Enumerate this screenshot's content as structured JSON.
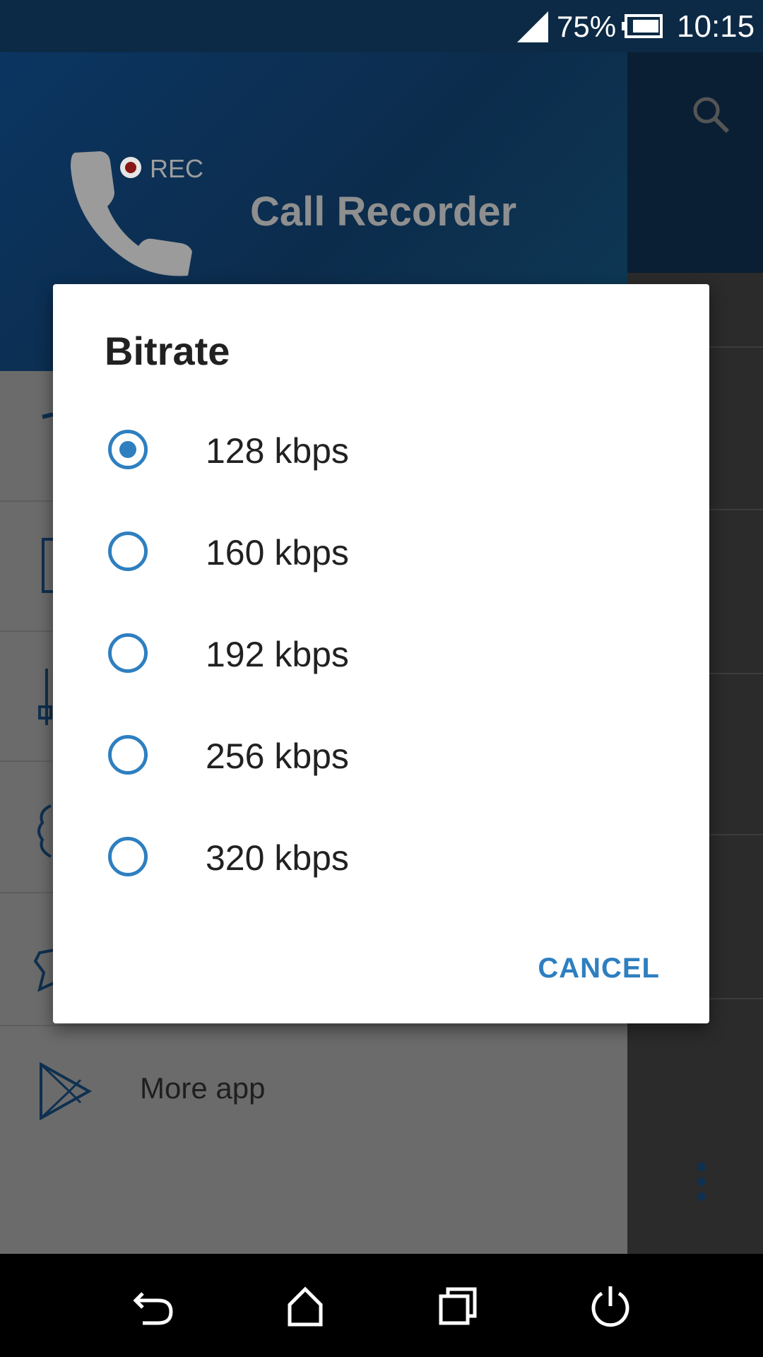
{
  "status_bar": {
    "battery_percent": "75%",
    "time": "10:15"
  },
  "drawer": {
    "header": {
      "rec_label": "REC",
      "app_title": "Call Recorder"
    },
    "items": [
      {
        "icon": "shield-icon"
      },
      {
        "icon": "sd-card-icon"
      },
      {
        "icon": "equalizer-icon"
      },
      {
        "icon": "gear-icon"
      },
      {
        "icon": "star-icon"
      },
      {
        "icon": "play-store-icon",
        "label": "More app"
      }
    ]
  },
  "dialog": {
    "title": "Bitrate",
    "options": [
      {
        "label": "128 kbps",
        "selected": true
      },
      {
        "label": "160 kbps",
        "selected": false
      },
      {
        "label": "192 kbps",
        "selected": false
      },
      {
        "label": "256 kbps",
        "selected": false
      },
      {
        "label": "320 kbps",
        "selected": false
      }
    ],
    "cancel_label": "CANCEL"
  },
  "colors": {
    "accent": "#2e7fc0",
    "status_bar": "#0c2a45",
    "header": "#0b3561"
  }
}
